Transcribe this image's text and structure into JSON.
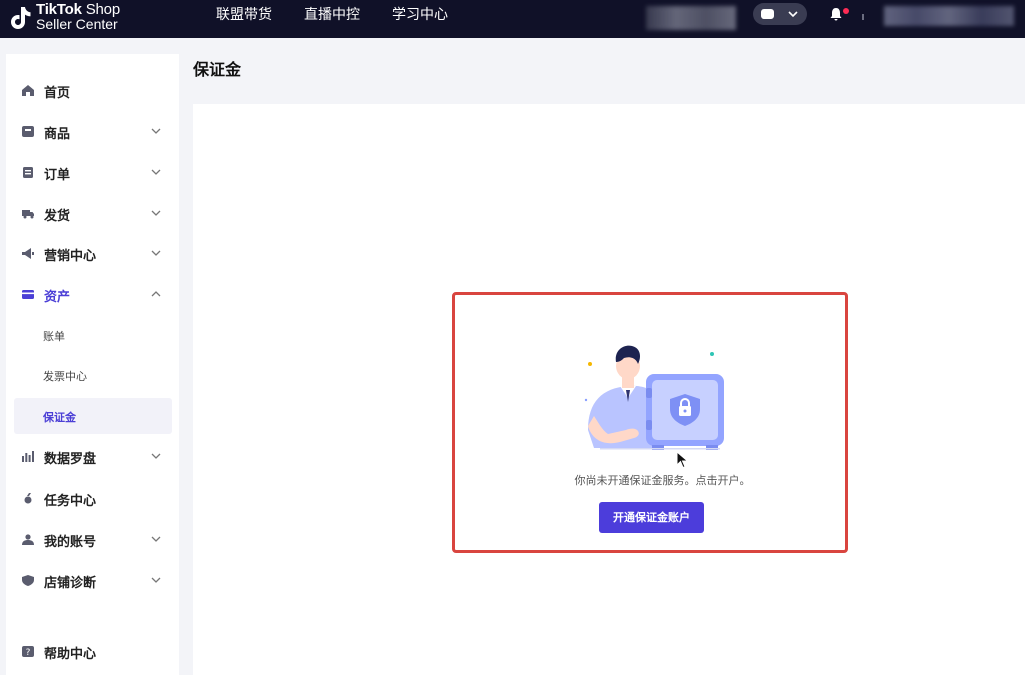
{
  "header": {
    "brand": {
      "name": "TikTok",
      "product": "Shop",
      "subtitle": "Seller Center"
    },
    "nav": [
      {
        "label": "联盟带货"
      },
      {
        "label": "直播中控"
      },
      {
        "label": "学习中心"
      }
    ]
  },
  "sidebar": {
    "items": [
      {
        "label": "首页",
        "icon": "home-icon"
      },
      {
        "label": "商品",
        "icon": "product-icon"
      },
      {
        "label": "订单",
        "icon": "order-icon"
      },
      {
        "label": "发货",
        "icon": "truck-icon"
      },
      {
        "label": "营销中心",
        "icon": "megaphone-icon"
      },
      {
        "label": "资产",
        "icon": "wallet-icon",
        "expanded": true
      },
      {
        "label": "数据罗盘",
        "icon": "bar-chart-icon"
      },
      {
        "label": "任务中心",
        "icon": "medal-icon"
      },
      {
        "label": "我的账号",
        "icon": "user-icon"
      },
      {
        "label": "店铺诊断",
        "icon": "shield-icon"
      },
      {
        "label": "帮助中心",
        "icon": "help-icon"
      }
    ],
    "asset_subitems": [
      {
        "label": "账单"
      },
      {
        "label": "发票中心"
      },
      {
        "label": "保证金",
        "selected": true
      }
    ]
  },
  "main": {
    "title": "保证金",
    "empty_message": "你尚未开通保证金服务。点击开户。",
    "open_button": "开通保证金账户"
  },
  "colors": {
    "accent": "#4c3ddb",
    "topbar": "#101128",
    "highlight_border": "#d9453f"
  }
}
